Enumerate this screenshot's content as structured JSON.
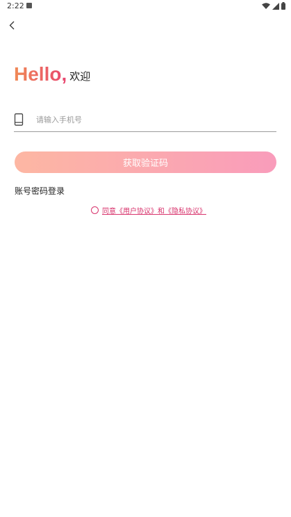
{
  "status_bar": {
    "time": "2:22"
  },
  "greeting": {
    "hello": "Hello,",
    "welcome": "欢迎"
  },
  "phone": {
    "placeholder": "请输入手机号",
    "value": ""
  },
  "buttons": {
    "get_code": "获取验证码",
    "account_login": "账号密码登录"
  },
  "agreement": {
    "prefix": "同意",
    "user_agreement": "《用户协议》",
    "and": "和",
    "privacy_agreement": "《隐私协议》"
  },
  "colors": {
    "accent": "#d8336c",
    "button_start": "#fdb7a3",
    "button_end": "#f99cbb",
    "hello_start": "#f08a56",
    "hello_end": "#e8456f"
  },
  "icons": {
    "back": "chevron-left-icon",
    "phone": "phone-icon",
    "wifi": "wifi-icon",
    "signal": "signal-icon",
    "battery": "battery-icon"
  }
}
